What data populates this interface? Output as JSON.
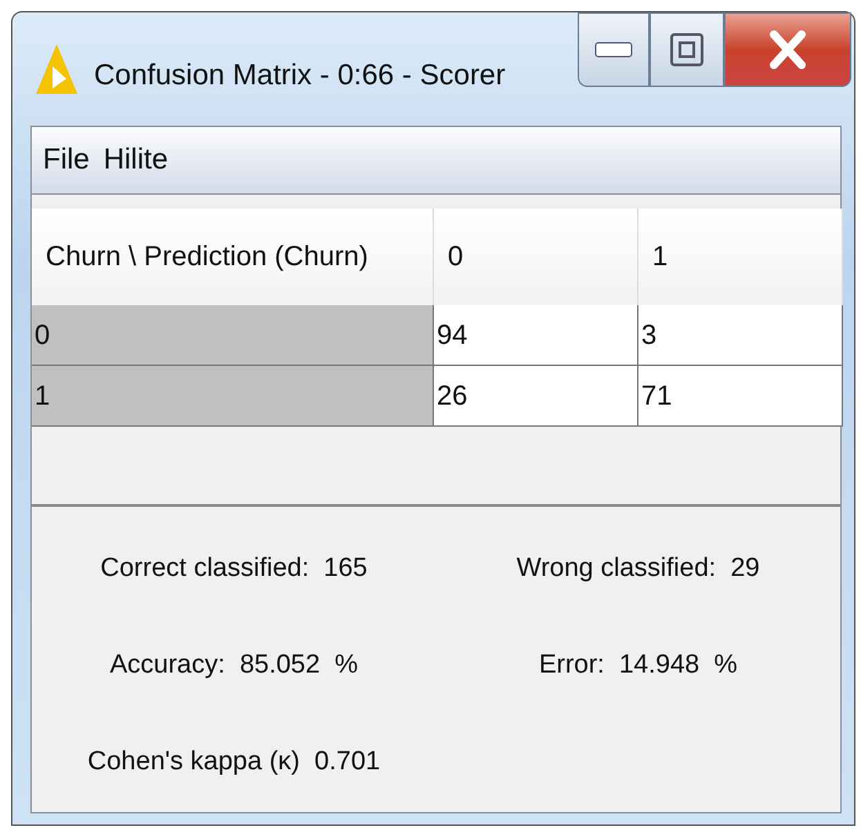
{
  "window": {
    "title": "Confusion Matrix - 0:66 - Scorer"
  },
  "menu": [
    "File",
    "Hilite"
  ],
  "table": {
    "columns": [
      "Churn \\ Prediction (Churn)",
      "0",
      "1"
    ],
    "rows": [
      [
        "0",
        "94",
        "3"
      ],
      [
        "1",
        "26",
        "71"
      ]
    ]
  },
  "stats": [
    [
      "Correct classified:  165",
      "Wrong classified:  29"
    ],
    [
      "Accuracy:  85.052  %",
      "Error:  14.948  %"
    ],
    [
      "Cohen's kappa (κ)  0.701"
    ]
  ]
}
